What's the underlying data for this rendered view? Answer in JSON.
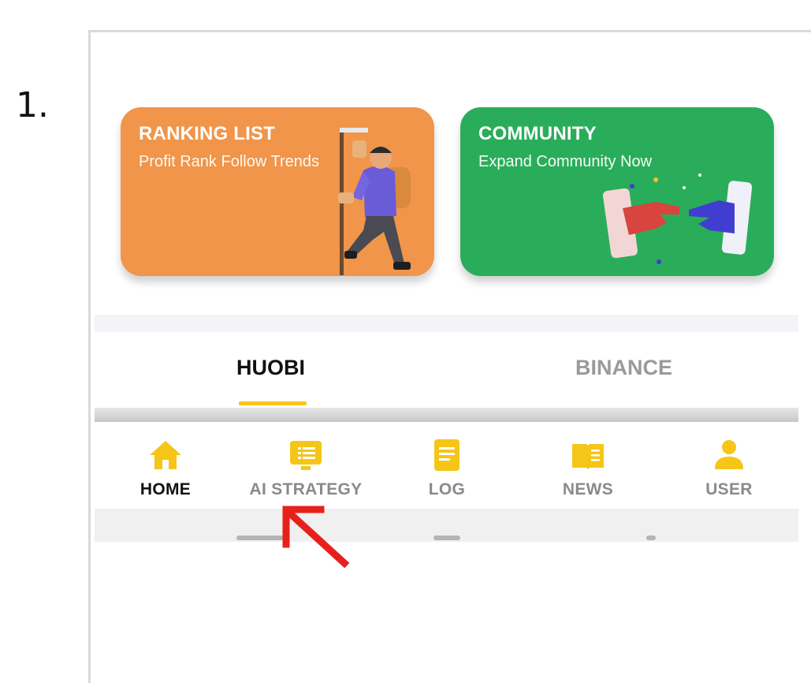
{
  "step": {
    "number": "1."
  },
  "cards": {
    "ranking": {
      "title": "RANKING LIST",
      "subtitle": "Profit Rank Follow Trends",
      "color": "#f0954a"
    },
    "community": {
      "title": "COMMUNITY",
      "subtitle": "Expand Community Now",
      "color": "#2aad5a"
    }
  },
  "exchange_tabs": [
    {
      "label": "HUOBI",
      "active": true
    },
    {
      "label": "BINANCE",
      "active": false
    }
  ],
  "bottom_nav": [
    {
      "label": "HOME",
      "icon": "home-icon",
      "active": true
    },
    {
      "label": "AI STRATEGY",
      "icon": "monitor-icon",
      "active": false
    },
    {
      "label": "LOG",
      "icon": "document-icon",
      "active": false
    },
    {
      "label": "NEWS",
      "icon": "book-icon",
      "active": false
    },
    {
      "label": "USER",
      "icon": "user-icon",
      "active": false
    }
  ],
  "colors": {
    "accent": "#f5c518",
    "annotation_arrow": "#e8201c",
    "inactive_label": "#8a8a8a"
  }
}
